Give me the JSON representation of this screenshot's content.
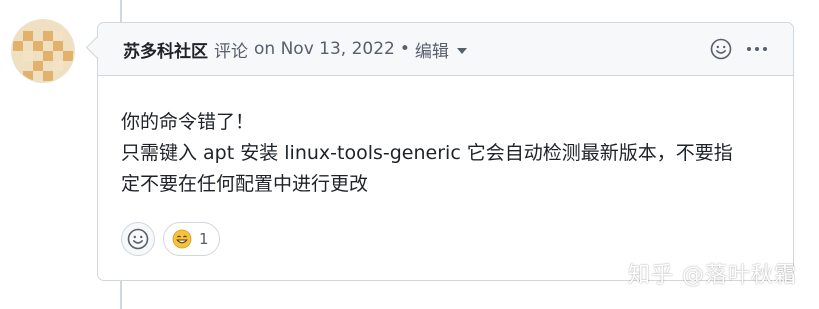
{
  "comment": {
    "author": "苏多科社区",
    "action": "评论",
    "date": "on Nov 13, 2022",
    "separator": "•",
    "edit_label": "编辑",
    "body_lines": [
      "你的命令错了！",
      "只需键入 apt 安装 linux-tools-generic 它会自动检测最新版本，不要指",
      "定不要在任何配置中进行更改"
    ]
  },
  "header_icons": [
    "smiley-icon",
    "kebab-menu-icon"
  ],
  "reactions": {
    "add_icon": "smiley-icon",
    "items": [
      {
        "emoji_icon": "grinning-face-icon",
        "count": "1"
      }
    ]
  },
  "watermark": "知乎 @落叶秋霜",
  "colors": {
    "border": "#d0d7de",
    "header_bg": "#f6f8fa",
    "text_primary": "#1f2328",
    "text_muted": "#57606a",
    "emoji_yellow": "#f5c33b"
  }
}
